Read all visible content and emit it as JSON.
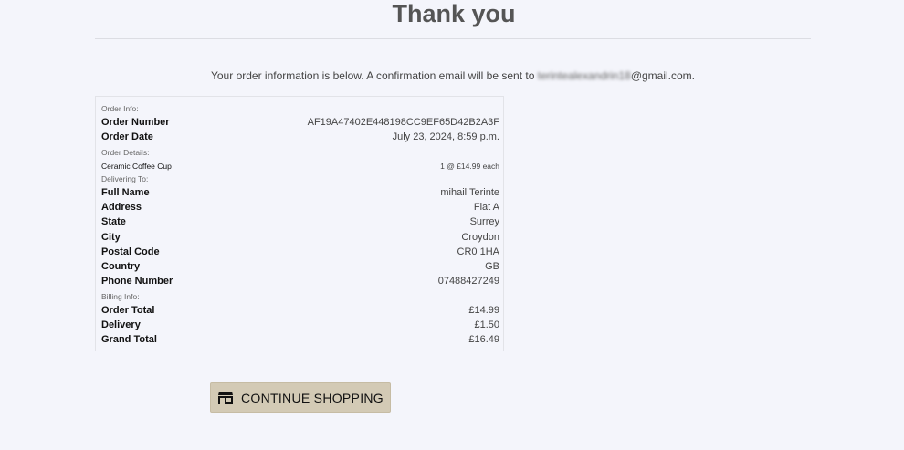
{
  "page": {
    "title": "Thank you",
    "intro_prefix": "Your order information is below. A confirmation email will be sent to ",
    "intro_email_user": "terintealexandrin18",
    "intro_email_domain": "@gmail.com."
  },
  "order": {
    "order_info_heading": "Order Info:",
    "order_number_label": "Order Number",
    "order_number": "AF19A47402E448198CC9EF65D42B2A3F",
    "order_date_label": "Order Date",
    "order_date": "July 23, 2024, 8:59 p.m.",
    "details_heading": "Order Details:",
    "item_name": "Ceramic Coffee Cup",
    "item_qty_price": "1 @ £14.99 each",
    "delivering_heading": "Delivering To:",
    "full_name_label": "Full Name",
    "full_name": "mihail Terinte",
    "address_label": "Address",
    "address": "Flat A",
    "state_label": "State",
    "state": "Surrey",
    "city_label": "City",
    "city": "Croydon",
    "postal_label": "Postal Code",
    "postal": "CR0 1HA",
    "country_label": "Country",
    "country": "GB",
    "phone_label": "Phone Number",
    "phone": "07488427249",
    "billing_heading": "Billing Info:",
    "order_total_label": "Order Total",
    "order_total": "£14.99",
    "delivery_label": "Delivery",
    "delivery": "£1.50",
    "grand_total_label": "Grand Total",
    "grand_total": "£16.49"
  },
  "actions": {
    "continue_label": "CONTINUE SHOPPING",
    "continue_icon": "shop-icon"
  },
  "colors": {
    "background": "#f4f5fb",
    "button": "#d3cab5"
  }
}
